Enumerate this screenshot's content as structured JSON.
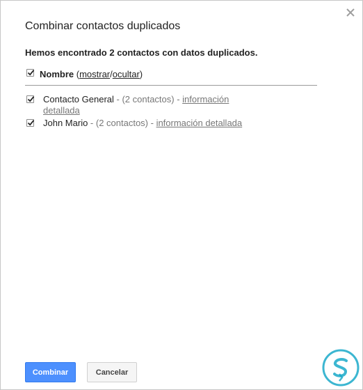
{
  "dialog": {
    "title": "Combinar contactos duplicados",
    "summary": "Hemos encontrado 2 contactos con datos duplicados.",
    "close_icon": "close-icon"
  },
  "field": {
    "label": "Nombre",
    "open_paren": " (",
    "show_link": "mostrar",
    "separator": "/",
    "hide_link": "ocultar",
    "close_paren": ")",
    "checked": true
  },
  "contacts": [
    {
      "name": "Contacto General",
      "count": " - (2 contactos) - ",
      "detail_link": "información detallada",
      "checked": true
    },
    {
      "name": "John Mario",
      "count": " - (2 contactos) - ",
      "detail_link": "información detallada",
      "checked": true
    }
  ],
  "buttons": {
    "primary": "Combinar",
    "secondary": "Cancelar"
  },
  "colors": {
    "primary_button": "#4d90fe",
    "watermark": "#1aa9c9"
  }
}
